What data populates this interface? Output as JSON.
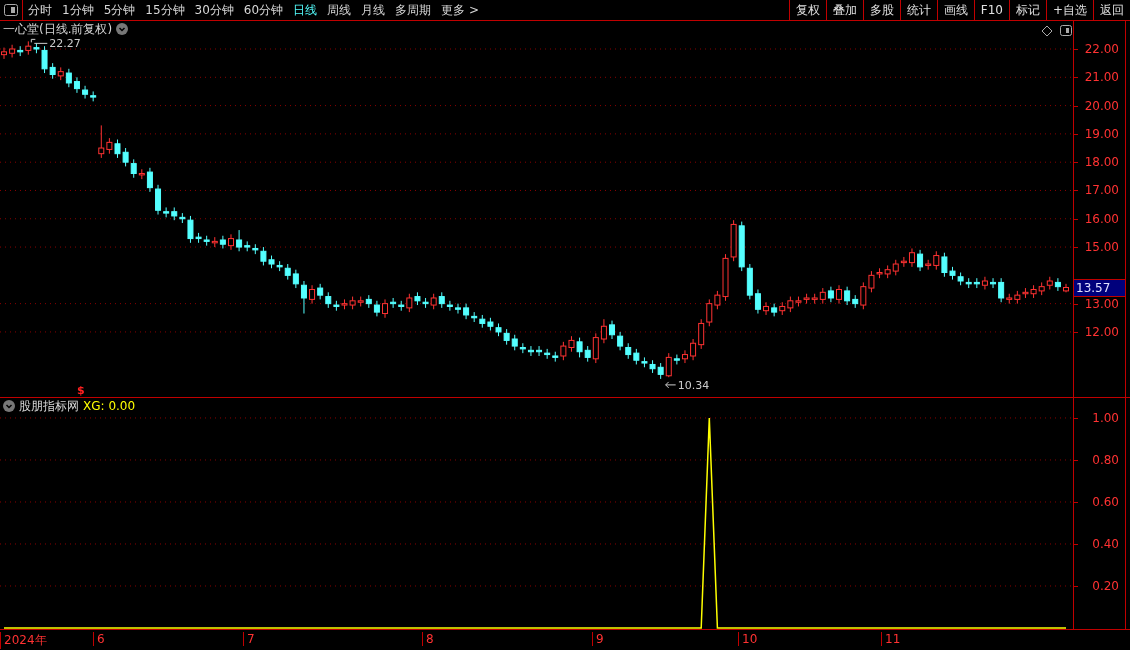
{
  "toolbar": {
    "periods": [
      {
        "label": "分时",
        "selected": false
      },
      {
        "label": "1分钟",
        "selected": false
      },
      {
        "label": "5分钟",
        "selected": false
      },
      {
        "label": "15分钟",
        "selected": false
      },
      {
        "label": "30分钟",
        "selected": false
      },
      {
        "label": "60分钟",
        "selected": false
      },
      {
        "label": "日线",
        "selected": true
      },
      {
        "label": "周线",
        "selected": false
      },
      {
        "label": "月线",
        "selected": false
      },
      {
        "label": "多周期",
        "selected": false
      },
      {
        "label": "更多 >",
        "selected": false
      }
    ],
    "actions": [
      "复权",
      "叠加",
      "多股",
      "统计",
      "画线",
      "F10",
      "标记",
      "+自选",
      "返回"
    ]
  },
  "price_panel": {
    "title": "一心堂(日线.前复权)",
    "high_label": "22.27",
    "low_label": "10.34",
    "marker": "$",
    "current_price": "13.57",
    "chart_data": {
      "type": "candlestick",
      "ylim": [
        9.7,
        22.99
      ],
      "grid": true,
      "yticks": [
        {
          "value": 22,
          "label": "22.00"
        },
        {
          "value": 21,
          "label": "21.00"
        },
        {
          "value": 20,
          "label": "20.00"
        },
        {
          "value": 19,
          "label": "19.00"
        },
        {
          "value": 18,
          "label": "18.00"
        },
        {
          "value": 17,
          "label": "17.00"
        },
        {
          "value": 16,
          "label": "16.00"
        },
        {
          "value": 15,
          "label": "15.00"
        },
        {
          "value": 13,
          "label": "13.00"
        },
        {
          "value": 12,
          "label": "12.00"
        }
      ],
      "ohlc": [
        [
          21.8,
          22.05,
          21.65,
          21.9
        ],
        [
          21.85,
          22.15,
          21.7,
          22.0
        ],
        [
          21.95,
          22.1,
          21.75,
          21.9
        ],
        [
          21.95,
          22.27,
          21.8,
          22.1
        ],
        [
          22.05,
          22.2,
          21.85,
          22.0
        ],
        [
          21.95,
          22.1,
          21.15,
          21.3
        ],
        [
          21.35,
          21.5,
          20.95,
          21.1
        ],
        [
          21.05,
          21.35,
          20.9,
          21.2
        ],
        [
          21.15,
          21.3,
          20.65,
          20.8
        ],
        [
          20.85,
          21.0,
          20.45,
          20.6
        ],
        [
          20.55,
          20.7,
          20.25,
          20.4
        ],
        [
          20.35,
          20.5,
          20.15,
          20.3
        ],
        [
          18.3,
          19.3,
          18.15,
          18.5
        ],
        [
          18.45,
          18.85,
          18.3,
          18.7
        ],
        [
          18.65,
          18.8,
          18.15,
          18.3
        ],
        [
          18.35,
          18.5,
          17.85,
          18.0
        ],
        [
          17.95,
          18.1,
          17.45,
          17.6
        ],
        [
          17.55,
          17.75,
          17.4,
          17.6
        ],
        [
          17.65,
          17.8,
          16.95,
          17.1
        ],
        [
          17.05,
          17.2,
          16.15,
          16.3
        ],
        [
          16.25,
          16.4,
          16.05,
          16.2
        ],
        [
          16.25,
          16.4,
          15.95,
          16.1
        ],
        [
          16.05,
          16.2,
          15.85,
          16.0
        ],
        [
          15.95,
          16.1,
          15.15,
          15.3
        ],
        [
          15.35,
          15.5,
          15.15,
          15.3
        ],
        [
          15.25,
          15.4,
          15.05,
          15.2
        ],
        [
          15.15,
          15.35,
          15.0,
          15.2
        ],
        [
          15.25,
          15.4,
          14.95,
          15.1
        ],
        [
          15.05,
          15.45,
          14.9,
          15.3
        ],
        [
          15.25,
          15.6,
          14.85,
          15.0
        ],
        [
          15.05,
          15.2,
          14.85,
          15.0
        ],
        [
          14.95,
          15.1,
          14.75,
          14.9
        ],
        [
          14.85,
          15.0,
          14.35,
          14.5
        ],
        [
          14.55,
          14.7,
          14.25,
          14.4
        ],
        [
          14.35,
          14.5,
          14.15,
          14.3
        ],
        [
          14.25,
          14.4,
          13.85,
          14.0
        ],
        [
          14.05,
          14.2,
          13.55,
          13.7
        ],
        [
          13.65,
          13.8,
          12.65,
          13.2
        ],
        [
          13.15,
          13.65,
          13.0,
          13.5
        ],
        [
          13.55,
          13.7,
          13.15,
          13.3
        ],
        [
          13.25,
          13.4,
          12.85,
          13.0
        ],
        [
          12.95,
          13.1,
          12.75,
          12.9
        ],
        [
          12.95,
          13.15,
          12.8,
          13.0
        ],
        [
          12.95,
          13.25,
          12.8,
          13.1
        ],
        [
          13.05,
          13.25,
          12.9,
          13.1
        ],
        [
          13.15,
          13.3,
          12.85,
          13.0
        ],
        [
          12.95,
          13.1,
          12.55,
          12.7
        ],
        [
          12.65,
          13.15,
          12.5,
          13.0
        ],
        [
          13.05,
          13.2,
          12.85,
          13.0
        ],
        [
          12.95,
          13.1,
          12.75,
          12.9
        ],
        [
          12.85,
          13.35,
          12.7,
          13.2
        ],
        [
          13.25,
          13.4,
          12.95,
          13.1
        ],
        [
          13.05,
          13.2,
          12.85,
          13.0
        ],
        [
          12.95,
          13.35,
          12.8,
          13.2
        ],
        [
          13.25,
          13.4,
          12.85,
          13.0
        ],
        [
          12.95,
          13.1,
          12.75,
          12.9
        ],
        [
          12.85,
          13.0,
          12.65,
          12.8
        ],
        [
          12.85,
          13.0,
          12.45,
          12.6
        ],
        [
          12.55,
          12.7,
          12.35,
          12.5
        ],
        [
          12.45,
          12.6,
          12.15,
          12.3
        ],
        [
          12.35,
          12.5,
          12.05,
          12.2
        ],
        [
          12.15,
          12.3,
          11.85,
          12.0
        ],
        [
          11.95,
          12.1,
          11.55,
          11.7
        ],
        [
          11.75,
          11.9,
          11.35,
          11.5
        ],
        [
          11.45,
          11.6,
          11.25,
          11.4
        ],
        [
          11.35,
          11.5,
          11.15,
          11.3
        ],
        [
          11.35,
          11.5,
          11.15,
          11.3
        ],
        [
          11.25,
          11.4,
          11.05,
          11.2
        ],
        [
          11.15,
          11.3,
          10.95,
          11.1
        ],
        [
          11.15,
          11.65,
          11.0,
          11.5
        ],
        [
          11.45,
          11.85,
          11.3,
          11.7
        ],
        [
          11.65,
          11.8,
          11.1,
          11.3
        ],
        [
          11.35,
          11.5,
          10.95,
          11.1
        ],
        [
          11.05,
          11.95,
          10.9,
          11.8
        ],
        [
          11.75,
          12.45,
          11.6,
          12.2
        ],
        [
          12.25,
          12.4,
          11.75,
          11.9
        ],
        [
          11.85,
          12.0,
          11.35,
          11.5
        ],
        [
          11.45,
          11.6,
          11.05,
          11.2
        ],
        [
          11.25,
          11.4,
          10.85,
          11.0
        ],
        [
          10.95,
          11.1,
          10.75,
          10.9
        ],
        [
          10.85,
          11.0,
          10.55,
          10.7
        ],
        [
          10.75,
          10.9,
          10.34,
          10.5
        ],
        [
          10.45,
          11.25,
          10.4,
          11.1
        ],
        [
          11.05,
          11.2,
          10.85,
          11.0
        ],
        [
          11.05,
          11.35,
          10.9,
          11.2
        ],
        [
          11.15,
          11.75,
          11.0,
          11.6
        ],
        [
          11.55,
          12.45,
          11.4,
          12.3
        ],
        [
          12.35,
          13.15,
          12.2,
          13.0
        ],
        [
          12.95,
          13.45,
          12.8,
          13.3
        ],
        [
          13.25,
          14.75,
          13.1,
          14.6
        ],
        [
          14.65,
          15.95,
          14.5,
          15.8
        ],
        [
          15.75,
          15.9,
          14.15,
          14.3
        ],
        [
          14.25,
          14.4,
          13.15,
          13.3
        ],
        [
          13.35,
          13.5,
          12.65,
          12.8
        ],
        [
          12.75,
          13.05,
          12.6,
          12.9
        ],
        [
          12.85,
          13.0,
          12.55,
          12.7
        ],
        [
          12.75,
          13.05,
          12.6,
          12.9
        ],
        [
          12.85,
          13.25,
          12.7,
          13.1
        ],
        [
          13.05,
          13.25,
          12.9,
          13.1
        ],
        [
          13.15,
          13.35,
          13.0,
          13.2
        ],
        [
          13.15,
          13.35,
          13.0,
          13.2
        ],
        [
          13.15,
          13.55,
          13.0,
          13.4
        ],
        [
          13.45,
          13.6,
          13.05,
          13.2
        ],
        [
          13.15,
          13.65,
          13.0,
          13.5
        ],
        [
          13.45,
          13.6,
          12.95,
          13.1
        ],
        [
          13.15,
          13.3,
          12.85,
          13.0
        ],
        [
          12.95,
          13.75,
          12.8,
          13.6
        ],
        [
          13.55,
          14.15,
          13.4,
          14.0
        ],
        [
          14.05,
          14.25,
          13.9,
          14.1
        ],
        [
          14.05,
          14.35,
          13.9,
          14.2
        ],
        [
          14.15,
          14.55,
          14.0,
          14.4
        ],
        [
          14.45,
          14.65,
          14.3,
          14.5
        ],
        [
          14.45,
          14.95,
          14.3,
          14.8
        ],
        [
          14.75,
          14.9,
          14.15,
          14.3
        ],
        [
          14.35,
          14.55,
          14.2,
          14.4
        ],
        [
          14.35,
          14.85,
          14.2,
          14.7
        ],
        [
          14.65,
          14.8,
          13.95,
          14.1
        ],
        [
          14.15,
          14.3,
          13.85,
          14.0
        ],
        [
          13.95,
          14.1,
          13.65,
          13.8
        ],
        [
          13.75,
          13.9,
          13.55,
          13.7
        ],
        [
          13.75,
          13.9,
          13.55,
          13.7
        ],
        [
          13.65,
          13.95,
          13.5,
          13.8
        ],
        [
          13.75,
          13.9,
          13.55,
          13.7
        ],
        [
          13.75,
          13.9,
          13.05,
          13.2
        ],
        [
          13.15,
          13.35,
          13.0,
          13.2
        ],
        [
          13.15,
          13.45,
          13.0,
          13.3
        ],
        [
          13.35,
          13.55,
          13.2,
          13.4
        ],
        [
          13.35,
          13.65,
          13.2,
          13.5
        ],
        [
          13.45,
          13.75,
          13.3,
          13.6
        ],
        [
          13.65,
          13.95,
          13.5,
          13.8
        ],
        [
          13.75,
          13.9,
          13.45,
          13.6
        ],
        [
          13.45,
          13.7,
          13.4,
          13.57
        ]
      ]
    }
  },
  "indicator_panel": {
    "title": "股朋指标网",
    "reading": "XG: 0.00",
    "chart_data": {
      "type": "line",
      "ylim": [
        0,
        1.095
      ],
      "grid": true,
      "yticks": [
        {
          "value": 0.2,
          "label": "0.20"
        },
        {
          "value": 0.4,
          "label": "0.40"
        },
        {
          "value": 0.6,
          "label": "0.60"
        },
        {
          "value": 0.8,
          "label": "0.80"
        },
        {
          "value": 1,
          "label": "1.00"
        }
      ],
      "series": [
        {
          "color": "#ffff00",
          "values": [
            0,
            0,
            0,
            0,
            0,
            0,
            0,
            0,
            0,
            0,
            0,
            0,
            0,
            0,
            0,
            0,
            0,
            0,
            0,
            0,
            0,
            0,
            0,
            0,
            0,
            0,
            0,
            0,
            0,
            0,
            0,
            0,
            0,
            0,
            0,
            0,
            0,
            0,
            0,
            0,
            0,
            0,
            0,
            0,
            0,
            0,
            0,
            0,
            0,
            0,
            0,
            0,
            0,
            0,
            0,
            0,
            0,
            0,
            0,
            0,
            0,
            0,
            0,
            0,
            0,
            0,
            0,
            0,
            0,
            0,
            0,
            0,
            0,
            0,
            0,
            0,
            0,
            0,
            0,
            0,
            0,
            0,
            0,
            0,
            0,
            0,
            0,
            1,
            0,
            0,
            0,
            0,
            0,
            0,
            0,
            0,
            0,
            0,
            0,
            0,
            0,
            0,
            0,
            0,
            0,
            0,
            0,
            0,
            0,
            0,
            0,
            0,
            0,
            0,
            0,
            0,
            0,
            0,
            0,
            0,
            0,
            0,
            0,
            0,
            0,
            0,
            0,
            0,
            0,
            0,
            0,
            0
          ]
        }
      ]
    }
  },
  "date_axis": [
    "2024年",
    "6",
    "7",
    "8",
    "9",
    "10",
    "11"
  ]
}
